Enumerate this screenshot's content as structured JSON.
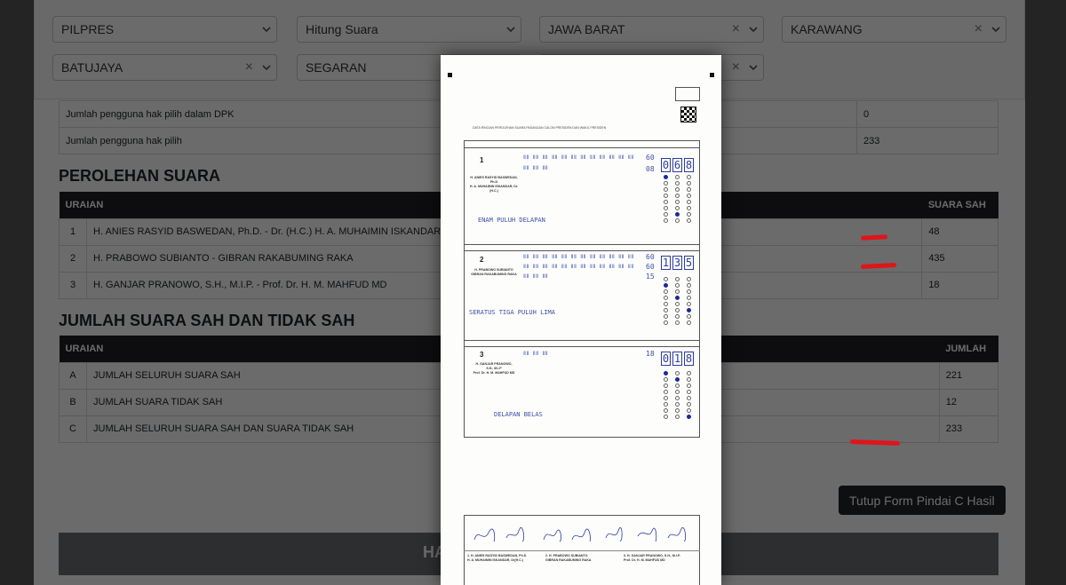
{
  "filters": {
    "row1": [
      {
        "value": "PILPRES",
        "clearable": false
      },
      {
        "value": "Hitung Suara",
        "clearable": false
      },
      {
        "value": "JAWA BARAT",
        "clearable": true
      },
      {
        "value": "KARAWANG",
        "clearable": true
      }
    ],
    "row2": [
      {
        "value": "BATUJAYA",
        "clearable": true
      },
      {
        "value": "SEGARAN",
        "clearable": false
      },
      {
        "value": "",
        "clearable": true
      }
    ]
  },
  "top_rows": [
    {
      "label": "Jumlah pengguna hak pilih dalam DPK",
      "value": "0"
    },
    {
      "label": "Jumlah pengguna hak pilih",
      "value": "233"
    }
  ],
  "perolehan": {
    "title": "PEROLEHAN SUARA",
    "col_uraian": "URAIAN",
    "col_suara": "SUARA SAH",
    "rows": [
      {
        "no": "1",
        "name": "H. ANIES RASYID BASWEDAN, Ph.D. - Dr. (H.C.) H. A. MUHAIMIN ISKANDAR",
        "value": "48"
      },
      {
        "no": "2",
        "name": "H. PRABOWO SUBIANTO - GIBRAN RAKABUMING RAKA",
        "value": "435"
      },
      {
        "no": "3",
        "name": "H. GANJAR PRANOWO, S.H., M.I.P. - Prof. Dr. H. M. MAHFUD MD",
        "value": "18"
      }
    ]
  },
  "jumlah": {
    "title": "JUMLAH SUARA SAH DAN TIDAK SAH",
    "col_uraian": "URAIAN",
    "col_jumlah": "JUMLAH",
    "rows": [
      {
        "no": "A",
        "name": "JUMLAH SELURUH SUARA SAH",
        "value": "221"
      },
      {
        "no": "B",
        "name": "JUMLAH SUARA TIDAK SAH",
        "value": "12"
      },
      {
        "no": "C",
        "name": "JUMLAH SELURUH SUARA SAH DAN SUARA TIDAK SAH",
        "value": "233"
      }
    ]
  },
  "close_button": "Tutup Form Pindai C Hasil",
  "bottom_bar_text": "HA",
  "scan": {
    "header_title": "DATA RINCIAN PEROLEHAN SUARA PASANGAN CALON PRESIDEN DAN WAKIL PRESIDEN",
    "candidates": [
      {
        "no": "1",
        "name": "H. ANIES RASYID BASWEDAN, Ph.D\nH. A. MUHAIMIN ISKANDAR, Dr. (H.C.)",
        "tally_lines": [
          "ⅡⅡ ⅡⅡ ⅡⅡ ⅡⅡ ⅡⅡ ⅡⅡ ⅡⅡ ⅡⅡ ⅡⅡ ⅡⅡ ⅡⅡ ⅡⅡ",
          "ⅡⅡ ⅡⅡ ⅡⅡ"
        ],
        "subtotals": [
          "60",
          "08"
        ],
        "digits": [
          "0",
          "6",
          "8"
        ],
        "words": "ENAM PULUH DELAPAN"
      },
      {
        "no": "2",
        "name": "H. PRABOWO SUBIANTO\nGIBRAN RAKABUMING RAKA",
        "tally_lines": [
          "ⅡⅡ ⅡⅡ ⅡⅡ ⅡⅡ ⅡⅡ ⅡⅡ ⅡⅡ ⅡⅡ ⅡⅡ ⅡⅡ ⅡⅡ ⅡⅡ",
          "ⅡⅡ ⅡⅡ ⅡⅡ ⅡⅡ ⅡⅡ ⅡⅡ ⅡⅡ ⅡⅡ ⅡⅡ ⅡⅡ ⅡⅡ ⅡⅡ",
          "ⅡⅡ ⅡⅡ ⅡⅡ"
        ],
        "subtotals": [
          "60",
          "60",
          "15"
        ],
        "digits": [
          "1",
          "3",
          "5"
        ],
        "words": "SERATUS TIGA PULUH LIMA"
      },
      {
        "no": "3",
        "name": "H. GANJAR PRANOWO,\nS.H., M.I.P\nProf. Dr. H. M. MAHFUD MD",
        "tally_lines": [
          "ⅡⅡ ⅡⅡ ⅡⅡ"
        ],
        "subtotals": [
          "18"
        ],
        "digits": [
          "0",
          "1",
          "8"
        ],
        "words": "DELAPAN BELAS"
      }
    ],
    "signature_names": [
      "1. H. ANIES RASYID BASWEDAN, Ph.D\nH. A. MUHAIMIN ISKANDAR, Dr(H.C.)",
      "2. H. PRABOWO SUBIANTO\nGIBRAN RAKABUMING RAKA",
      "3. H. GANJAR PRANOWO, S.H., M.I.P.\nProf. Dr. H. M. MAHFUD MD"
    ]
  },
  "colors": {
    "annotation_red": "#e0141b",
    "ink_blue": "#2b3aa0",
    "header_dark": "#1f2124"
  }
}
